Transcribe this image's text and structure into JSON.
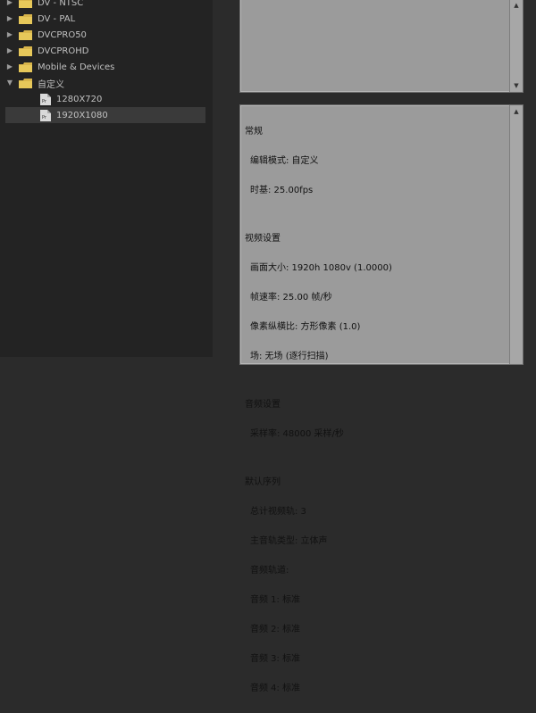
{
  "tree": [
    {
      "label": "DV - NTSC",
      "expanded": false,
      "type": "folder"
    },
    {
      "label": "DV - PAL",
      "expanded": false,
      "type": "folder"
    },
    {
      "label": "DVCPRO50",
      "expanded": false,
      "type": "folder"
    },
    {
      "label": "DVCPROHD",
      "expanded": false,
      "type": "folder"
    },
    {
      "label": "Mobile & Devices",
      "expanded": false,
      "type": "folder"
    },
    {
      "label": "自定义",
      "expanded": true,
      "type": "folder"
    },
    {
      "label": "1280X720",
      "type": "preset",
      "selected": false
    },
    {
      "label": "1920X1080",
      "type": "preset",
      "selected": true
    }
  ],
  "details": {
    "general": {
      "title": "常规",
      "items": [
        "编辑模式: 自定义",
        "时基: 25.00fps"
      ]
    },
    "video": {
      "title": "视频设置",
      "items": [
        "画面大小: 1920h 1080v (1.0000)",
        "帧速率: 25.00 帧/秒",
        "像素纵横比: 方形像素 (1.0)",
        "场: 无场 (逐行扫描)"
      ]
    },
    "audio": {
      "title": "音频设置",
      "items": [
        "采样率: 48000 采样/秒"
      ]
    },
    "sequence": {
      "title": "默认序列",
      "items": [
        "总计视频轨: 3",
        "主音轨类型: 立体声",
        "音频轨道:",
        "音频 1: 标准",
        "音频 2: 标准",
        "音频 3: 标准",
        "音频 4: 标准"
      ]
    }
  },
  "colors": {
    "panel_bg": "#232323",
    "box_bg": "#9b9b9b",
    "folder": "#d8b54b"
  }
}
